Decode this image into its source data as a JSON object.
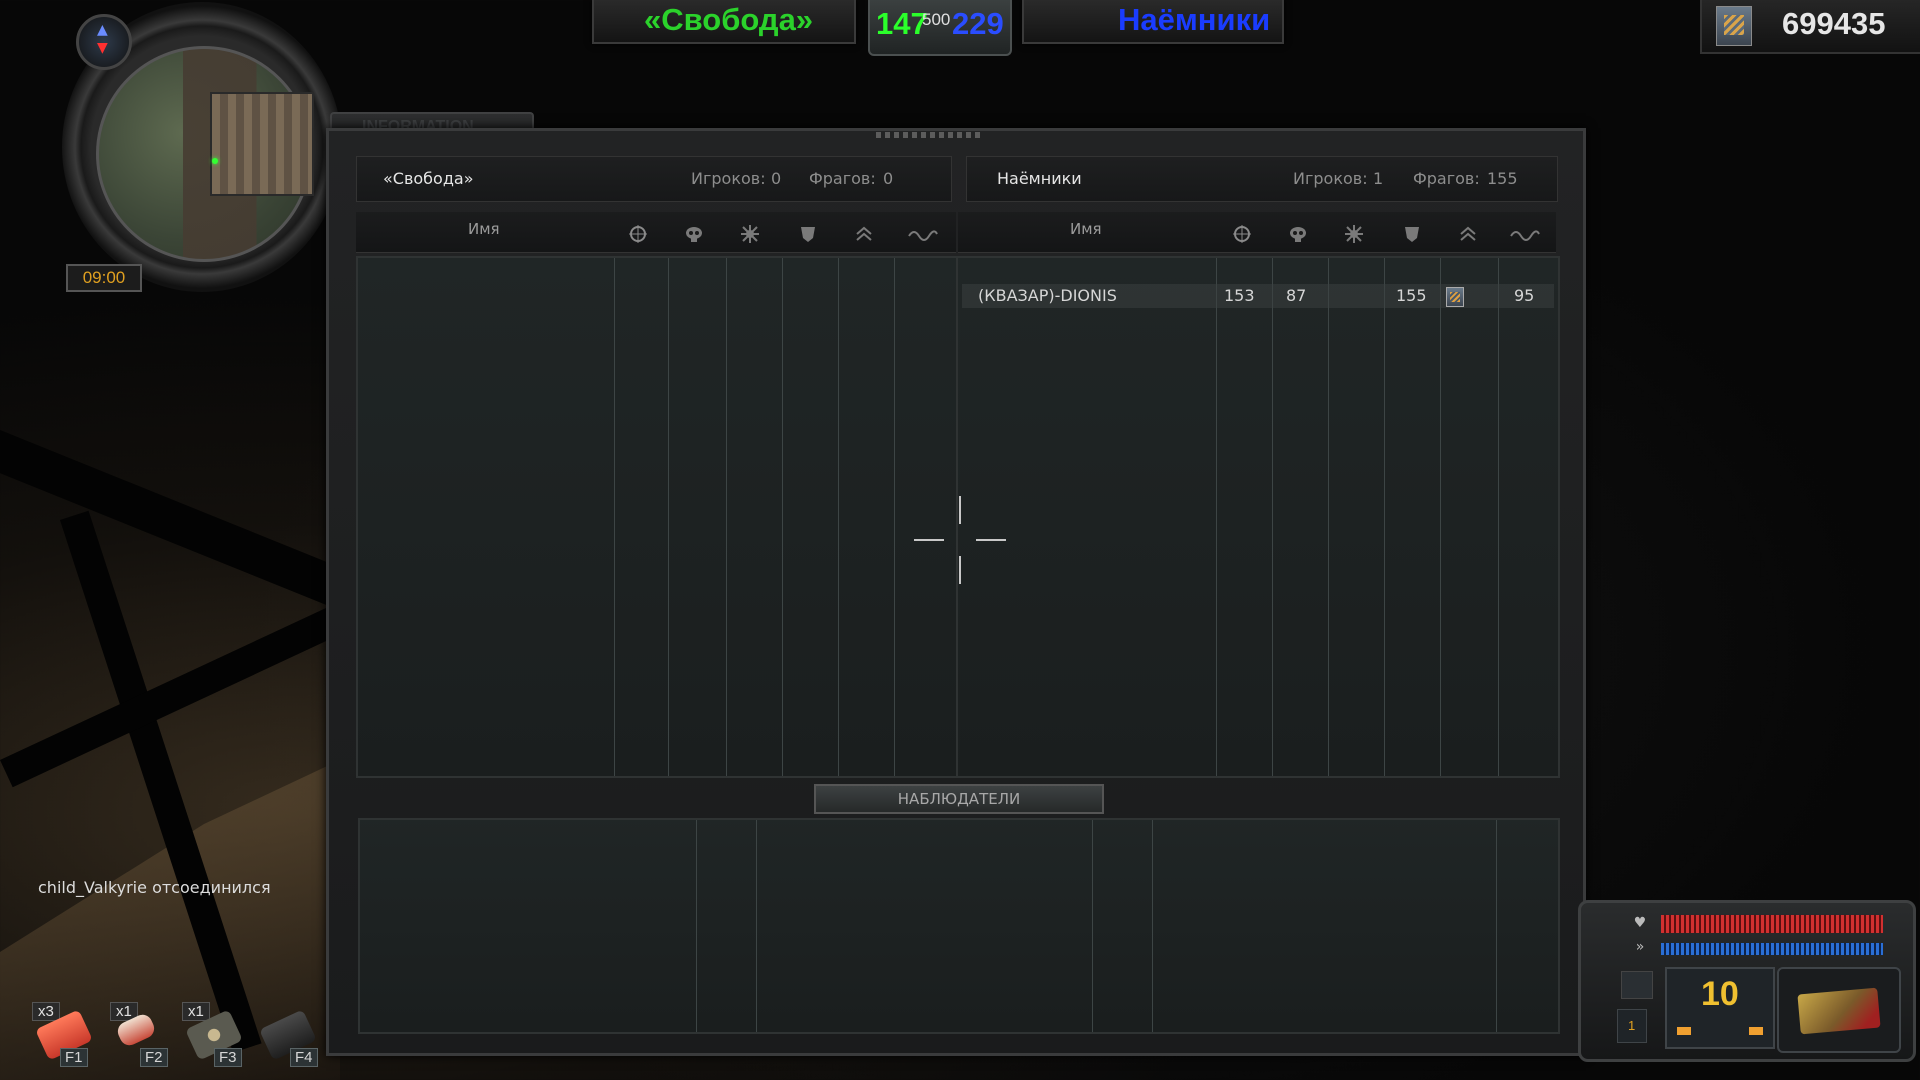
{
  "top_bar": {
    "team_left": "«Свобода»",
    "team_right": "Наёмники",
    "score_left": "147",
    "score_limit": "500",
    "score_right": "229",
    "money": "699435",
    "colors": {
      "team_left": "#2bd22b",
      "team_right": "#1a3cff",
      "score_left": "#2bff2b",
      "score_right": "#2a4dff"
    }
  },
  "minimap": {
    "time": "09:00"
  },
  "panel": {
    "tab_label": "INFORMATION",
    "left_team": {
      "name": "«Свобода»",
      "players_label": "Игроков:",
      "players": "0",
      "frags_label": "Фрагов:",
      "frags": "0"
    },
    "right_team": {
      "name": "Наёмники",
      "players_label": "Игроков:",
      "players": "1",
      "frags_label": "Фрагов:",
      "frags": "155"
    },
    "columns": {
      "name_header": "Имя"
    },
    "rows": [
      {
        "name": "(КВАЗАР)-DIONIS",
        "kills": "153",
        "deaths": "87",
        "frags": "155",
        "ping": "95"
      }
    ],
    "spectators_label": "НАБЛЮДАТЕЛИ"
  },
  "chat": {
    "player": "child_Valkyrie",
    "message": "отсоединился"
  },
  "quick_slots": [
    {
      "qty": "x3",
      "key": "F1"
    },
    {
      "qty": "x1",
      "key": "F2"
    },
    {
      "qty": "x1",
      "key": "F3"
    },
    {
      "qty": "",
      "key": "F4"
    }
  ],
  "status": {
    "ammo": "10",
    "grenades": "1"
  }
}
